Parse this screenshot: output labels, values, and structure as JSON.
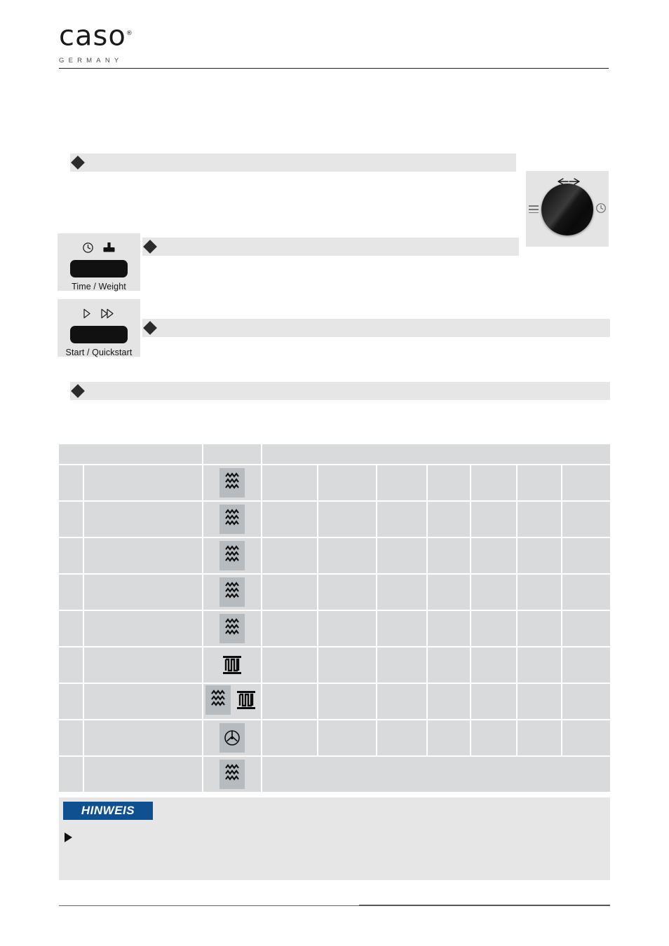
{
  "brand": {
    "name": "caso",
    "registered": "®",
    "tagline": "GERMANY"
  },
  "bullets": [
    {
      "id": "bullet-1",
      "text": "",
      "marker": "diamond"
    },
    {
      "id": "bullet-2",
      "text": "",
      "marker": "diamond"
    },
    {
      "id": "bullet-3",
      "text": "",
      "marker": "diamond"
    },
    {
      "id": "bullet-4",
      "text": "",
      "marker": "diamond"
    }
  ],
  "controls": [
    {
      "id": "time-weight",
      "label": "Time / Weight",
      "icons": [
        "clock-icon",
        "weight-icon"
      ]
    },
    {
      "id": "start-quickstart",
      "label": "Start / Quickstart",
      "icons": [
        "play-icon",
        "fast-forward-icon"
      ]
    }
  ],
  "knob": {
    "name": "rotary-selector-knob",
    "left_icon": "menu-icon",
    "right_icon": "clock-icon",
    "top_icon": "bidirectional-arrows-icon"
  },
  "table": {
    "header": [
      "",
      "",
      ""
    ],
    "columns": 9,
    "rows": [
      {
        "no": "",
        "name": "",
        "mode": "microwave",
        "c1": "",
        "c2": "",
        "c3": "",
        "c4": "",
        "c5": "",
        "c6": "",
        "c7": ""
      },
      {
        "no": "",
        "name": "",
        "mode": "microwave",
        "c1": "",
        "c2": "",
        "c3": "",
        "c4": "",
        "c5": "",
        "c6": "",
        "c7": ""
      },
      {
        "no": "",
        "name": "",
        "mode": "microwave",
        "c1": "",
        "c2": "",
        "c3": "",
        "c4": "",
        "c5": "",
        "c6": "",
        "c7": ""
      },
      {
        "no": "",
        "name": "",
        "mode": "microwave",
        "c1": "",
        "c2": "",
        "c3": "",
        "c4": "",
        "c5": "",
        "c6": "",
        "c7": ""
      },
      {
        "no": "",
        "name": "",
        "mode": "microwave",
        "c1": "",
        "c2": "",
        "c3": "",
        "c4": "",
        "c5": "",
        "c6": "",
        "c7": ""
      },
      {
        "no": "",
        "name": "",
        "mode": "grill",
        "c1": "",
        "c2": "",
        "c3": "",
        "c4": "",
        "c5": "",
        "c6": "",
        "c7": ""
      },
      {
        "no": "",
        "name": "",
        "mode": "microwave-grill",
        "c1": "",
        "c2": "",
        "c3": "",
        "c4": "",
        "c5": "",
        "c6": "",
        "c7": ""
      },
      {
        "no": "",
        "name": "",
        "mode": "convection-fan",
        "c1": "",
        "c2": "",
        "c3": "",
        "c4": "",
        "c5": "",
        "c6": "",
        "c7": ""
      },
      {
        "no": "",
        "name": "",
        "mode": "microwave",
        "merged": ""
      }
    ]
  },
  "note": {
    "banner": "HINWEIS",
    "marker": "triangle-right",
    "text": ""
  },
  "colors": {
    "note_blue": "#0f5190",
    "bar_gray": "#e6e6e6",
    "cell_gray": "#d9dadb",
    "chip_gray": "#b5bbbf",
    "panel_gray": "#e4e4e4"
  }
}
